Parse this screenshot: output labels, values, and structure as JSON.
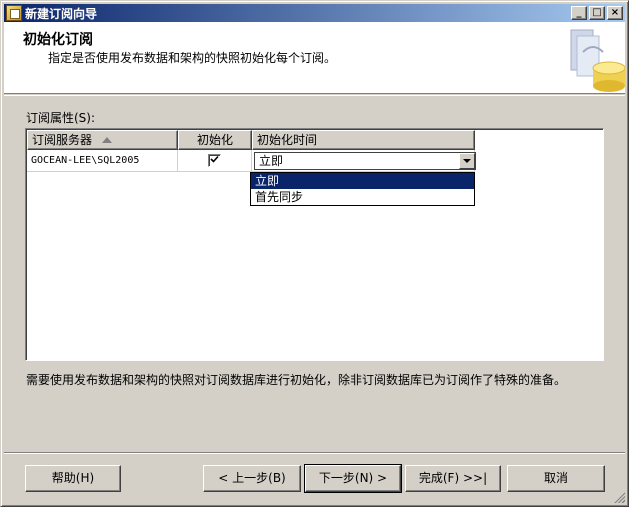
{
  "window": {
    "title": "新建订阅向导",
    "controls": {
      "minimize": "_",
      "maximize": "□",
      "close": "×"
    }
  },
  "header": {
    "title": "初始化订阅",
    "description": "指定是否使用发布数据和架构的快照初始化每个订阅。"
  },
  "properties": {
    "label": "订阅属性(S):",
    "columns": [
      "订阅服务器",
      "初始化",
      "初始化时间"
    ],
    "rows": [
      {
        "subscriber": "GOCEAN-LEE\\SQL2005",
        "initialize": true,
        "init_time": "立即"
      }
    ],
    "dropdown_options": [
      "立即",
      "首先同步"
    ],
    "dropdown_selected": "立即"
  },
  "note": "需要使用发布数据和架构的快照对订阅数据库进行初始化，除非订阅数据库已为订阅作了特殊的准备。",
  "buttons": {
    "help": "帮助(H)",
    "back": "< 上一步(B)",
    "next": "下一步(N) >",
    "finish": "完成(F) >>|",
    "cancel": "取消"
  },
  "colors": {
    "title_bar": "#0a246a",
    "selection": "#0a246a",
    "face": "#d4d0c8"
  }
}
